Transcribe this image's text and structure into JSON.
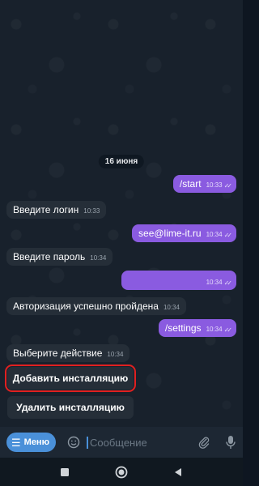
{
  "chat": {
    "date_label": "16 июня",
    "messages": [
      {
        "dir": "out",
        "text": "/start",
        "time": "10:33",
        "checks": "✓✓"
      },
      {
        "dir": "in",
        "text": "Введите логин",
        "time": "10:33"
      },
      {
        "dir": "out",
        "text": "see@lime-it.ru",
        "time": "10:34",
        "checks": "✓✓"
      },
      {
        "dir": "in",
        "text": "Введите пароль",
        "time": "10:34"
      },
      {
        "dir": "out",
        "text": "",
        "time": "10:34",
        "checks": "✓✓"
      },
      {
        "dir": "in",
        "text": "Авторизация успешно пройдена",
        "time": "10:34"
      },
      {
        "dir": "out",
        "text": "/settings",
        "time": "10:34",
        "checks": "✓✓"
      },
      {
        "dir": "in",
        "text": "Выберите действие",
        "time": "10:34"
      }
    ]
  },
  "keyboard": {
    "buttons": [
      {
        "label": "Добавить инсталляцию",
        "highlighted": true
      },
      {
        "label": "Удалить инсталляцию",
        "highlighted": false
      }
    ]
  },
  "input_bar": {
    "menu_label": "Меню",
    "placeholder": "Сообщение",
    "menu_icon": "menu-icon",
    "emoji_icon": "emoji-icon",
    "attach_icon": "paperclip-icon",
    "mic_icon": "microphone-icon"
  },
  "colors": {
    "background": "#18212c",
    "incoming_bubble": "#252e38",
    "outgoing_bubble": "#8a5be0",
    "accent": "#4a90d9",
    "highlight_outline": "#e02020"
  }
}
